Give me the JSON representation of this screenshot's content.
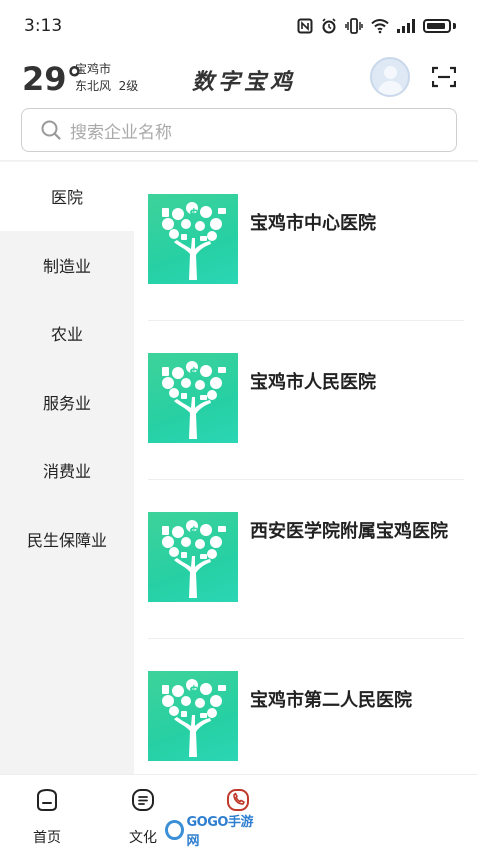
{
  "status_bar": {
    "time": "3:13",
    "icons": [
      "nfc-icon",
      "alarm-icon",
      "vibrate-icon",
      "wifi-icon",
      "signal-icon",
      "battery-icon"
    ]
  },
  "header": {
    "temperature": "29°",
    "city": "宝鸡市",
    "wind": "东北风  2级",
    "brand": "数字宝鸡"
  },
  "search": {
    "placeholder": "搜索企业名称"
  },
  "sidebar": {
    "items": [
      {
        "label": "医院",
        "active": true
      },
      {
        "label": "制造业",
        "active": false
      },
      {
        "label": "农业",
        "active": false
      },
      {
        "label": "服务业",
        "active": false
      },
      {
        "label": "消费业",
        "active": false
      },
      {
        "label": "民生保障业",
        "active": false
      }
    ]
  },
  "list": {
    "items": [
      {
        "name": "宝鸡市中心医院"
      },
      {
        "name": "宝鸡市人民医院"
      },
      {
        "name": "西安医学院附属宝鸡医院"
      },
      {
        "name": "宝鸡市第二人民医院"
      }
    ]
  },
  "bottom_nav": {
    "items": [
      {
        "label": "首页",
        "icon": "home-icon"
      },
      {
        "label": "文化",
        "icon": "document-icon"
      },
      {
        "label": "",
        "icon": "phone-icon"
      }
    ]
  },
  "watermark": {
    "text": "GOGO手游网"
  },
  "colors": {
    "accent_red": "#c0392b",
    "logo_green": "#2fd3a0",
    "sidebar_bg": "#f3f3f3"
  }
}
